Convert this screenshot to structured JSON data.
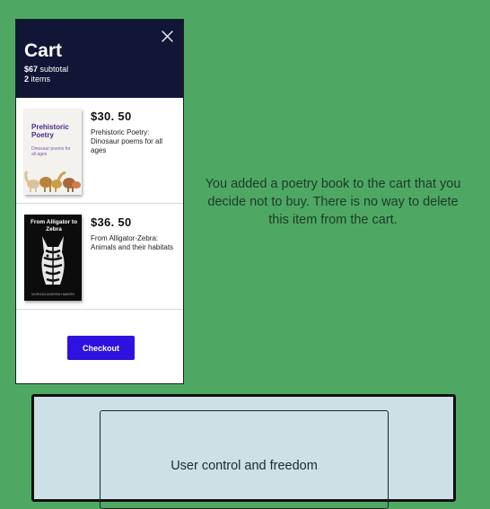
{
  "cart": {
    "title": "Cart",
    "subtotal_value": "$67",
    "subtotal_label": "subtotal",
    "items_count": "2",
    "items_label": "items",
    "close_icon": "close-icon",
    "items": [
      {
        "price": "$30. 50",
        "description": "Prehistoric Poetry: Dinosaur poems for all ages",
        "cover_title": "Prehistoric Poetry",
        "cover_subtitle": "Dinosaur poems for all ages"
      },
      {
        "price": "$36. 50",
        "description": "From Alligator-Zebra: Animals and their habitats",
        "cover_title": "From Alligator to Zebra",
        "cover_author": "MORGAN ANDREW HABERS"
      }
    ],
    "checkout_label": "Checkout"
  },
  "caption": "You added a poetry book to the cart that you decide not to buy. There is no way to delete this item from the cart.",
  "principle": "User control and freedom",
  "colors": {
    "background": "#4ea864",
    "header": "#111536",
    "checkout": "#2d12e0",
    "card": "#cde0e6"
  }
}
